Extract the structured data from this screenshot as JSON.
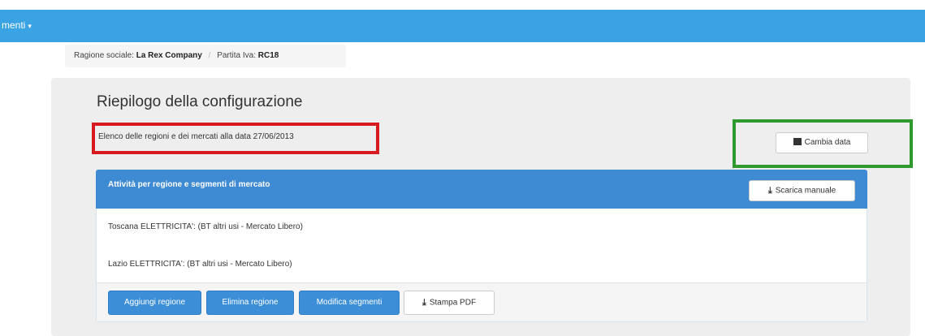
{
  "topbar": {
    "menu_label": "menti",
    "caret": "▾",
    "color": "#3aa3e3"
  },
  "breadcrumb": {
    "ragione_label": "Ragione sociale:",
    "ragione_value": "La Rex Company",
    "separator": "/",
    "piva_label": "Partita Iva:",
    "piva_value": "RC18"
  },
  "summary": {
    "title": "Riepilogo della configurazione",
    "date_text": "Elenco delle regioni e dei mercati alla data 27/06/2013",
    "change_date_label": "Cambia data",
    "change_date_icon": "calendar-icon"
  },
  "panel": {
    "title": "Attività per regione e segmenti di mercato",
    "download_label": "Scarica manuale",
    "download_icon": "download-icon",
    "rows": [
      "Toscana ELETTRICITA': (BT altri usi - Mercato Libero)",
      "Lazio ELETTRICITA': (BT altri usi - Mercato Libero)"
    ]
  },
  "footer": {
    "add_region": "Aggiungi regione",
    "remove_region": "Elimina regione",
    "edit_segments": "Modifica segmenti",
    "print_pdf": "Stampa PDF"
  },
  "annotations": {
    "red_box_color": "#d71920",
    "green_box_color": "#2e9a2e"
  }
}
